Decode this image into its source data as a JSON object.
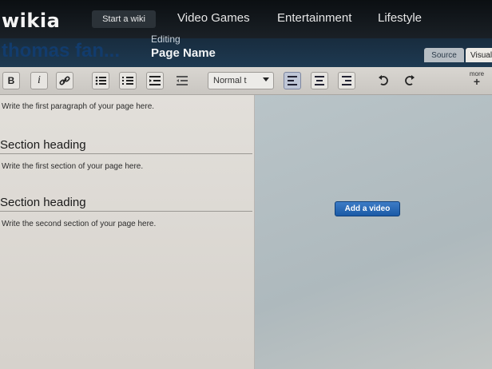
{
  "nav": {
    "logo": "wikia",
    "start_wiki": "Start a wiki",
    "links": [
      "Video Games",
      "Entertainment",
      "Lifestyle"
    ]
  },
  "header": {
    "wiki_name": "thomas fan...",
    "editing_label": "Editing",
    "page_name": "Page Name",
    "tabs": [
      "Source",
      "Visual"
    ]
  },
  "toolbar": {
    "bold": "B",
    "italic": "i",
    "format_value": "Normal t",
    "more_label": "more",
    "more_plus": "+"
  },
  "editor": {
    "intro": "Write the first paragraph of your page here.",
    "sections": [
      {
        "heading": "Section heading",
        "body": "Write the first section of your page here."
      },
      {
        "heading": "Section heading",
        "body": "Write the second section of your page here."
      }
    ]
  },
  "video": {
    "add_button": "Add a video"
  }
}
